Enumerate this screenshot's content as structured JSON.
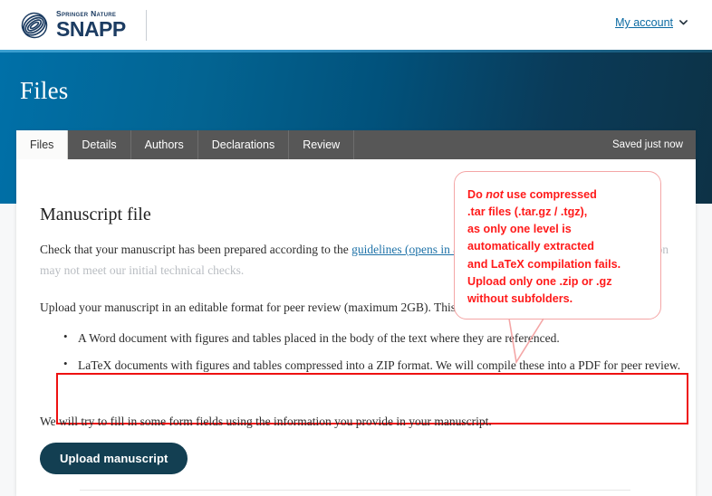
{
  "header": {
    "logo": {
      "brand_line": "Springer Nature",
      "product": "SNAPP",
      "icon": "springer-nature-logo-icon"
    },
    "account_label": "My account",
    "chevron_icon": "chevron-down-icon"
  },
  "hero": {
    "title": "Files"
  },
  "tabs": [
    {
      "label": "Files",
      "active": true
    },
    {
      "label": "Details",
      "active": false
    },
    {
      "label": "Authors",
      "active": false
    },
    {
      "label": "Declarations",
      "active": false
    },
    {
      "label": "Review",
      "active": false
    }
  ],
  "status": {
    "saved_text": "Saved just now"
  },
  "main": {
    "section_title": "Manuscript file",
    "paragraph_1_before_link": "Check that your manuscript has been prepared according to the ",
    "paragraph_1_link": "guidelines (opens in a new window)",
    "paragraph_1_after_link": ". Otherwise your submission may not meet our initial technical checks.",
    "paragraph_2": "Upload your manuscript in an editable format for peer review (maximum 2GB). This will be either:",
    "bullets": [
      "A Word document with figures and tables placed in the body of the text where they are referenced.",
      "LaTeX documents with figures and tables compressed into a ZIP format. We will compile these into a PDF for peer review."
    ],
    "paragraph_3": "We will try to fill in some form fields using the information you provide in your manuscript.",
    "upload_button_label": "Upload manuscript"
  },
  "annotation": {
    "callout_lines": [
      "Do not use compressed",
      ".tar files (.tar.gz / .tgz),",
      "as only one level is",
      "automatically extracted",
      "and LaTeX compilation fails.",
      "Upload only one .zip or .gz",
      "without subfolders."
    ],
    "callout_line_1_prefix": "Do ",
    "callout_line_1_italic": "not",
    "callout_line_1_suffix": " use compressed",
    "highlight_color": "#ff1a1a",
    "box_color": "#ee1111"
  },
  "colors": {
    "brand_navy": "#1c3c62",
    "hero_blue_left": "#0070a8",
    "hero_navy_right": "#0d3246",
    "link_blue": "#1e72a8",
    "tab_bar": "#575757",
    "button_navy": "#133f52"
  }
}
